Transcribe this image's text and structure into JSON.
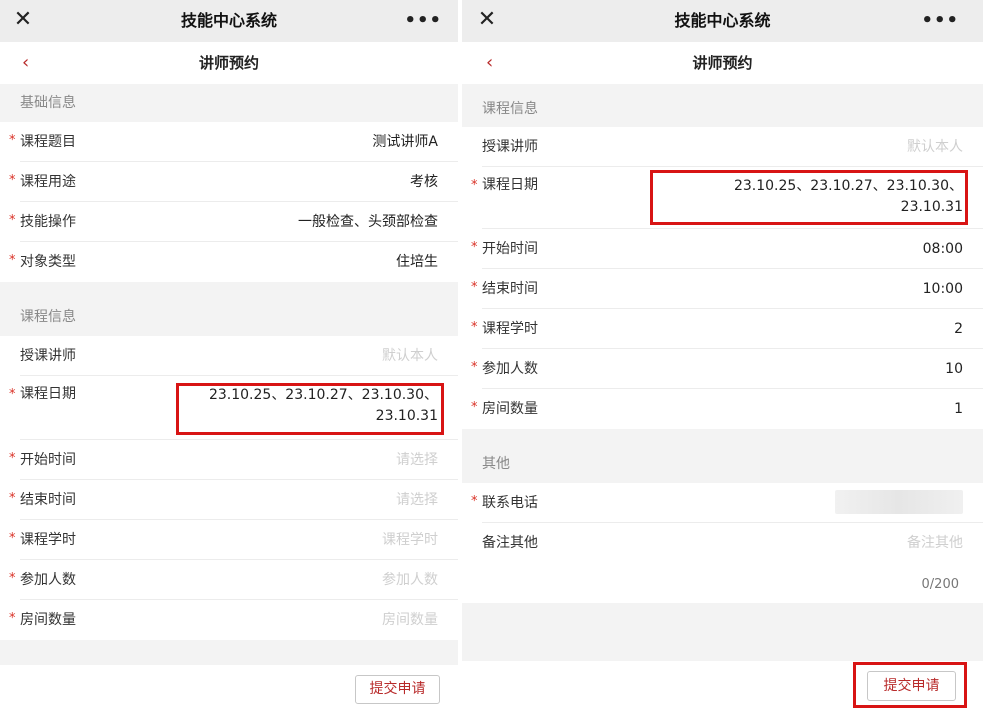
{
  "app_title": "技能中心系统",
  "page_title": "讲师预约",
  "icons": {
    "close": "close-icon",
    "more": "more-icon",
    "back": "back-icon"
  },
  "colors": {
    "accent": "#b82a2a",
    "required": "#d93025",
    "highlight": "#d81414"
  },
  "left": {
    "basic_section": "基础信息",
    "basic_rows": [
      {
        "label": "课程题目",
        "value": "测试讲师A",
        "required": true
      },
      {
        "label": "课程用途",
        "value": "考核",
        "required": true
      },
      {
        "label": "技能操作",
        "value": "一般检查、头颈部检查",
        "required": true
      },
      {
        "label": "对象类型",
        "value": "住培生",
        "required": true
      }
    ],
    "course_section": "课程信息",
    "teacher": {
      "label": "授课讲师",
      "placeholder": "默认本人"
    },
    "date": {
      "label": "课程日期",
      "line1": "23.10.25、23.10.27、23.10.30、",
      "line2": "23.10.31"
    },
    "rows": [
      {
        "label": "开始时间",
        "placeholder": "请选择"
      },
      {
        "label": "结束时间",
        "placeholder": "请选择"
      },
      {
        "label": "课程学时",
        "placeholder": "课程学时"
      },
      {
        "label": "参加人数",
        "placeholder": "参加人数"
      },
      {
        "label": "房间数量",
        "placeholder": "房间数量"
      }
    ],
    "submit": "提交申请"
  },
  "right": {
    "course_section": "课程信息",
    "teacher": {
      "label": "授课讲师",
      "placeholder": "默认本人"
    },
    "date": {
      "label": "课程日期",
      "line1": "23.10.25、23.10.27、23.10.30、",
      "line2": "23.10.31"
    },
    "rows": [
      {
        "label": "开始时间",
        "value": "08:00"
      },
      {
        "label": "结束时间",
        "value": "10:00"
      },
      {
        "label": "课程学时",
        "value": "2"
      },
      {
        "label": "参加人数",
        "value": "10"
      },
      {
        "label": "房间数量",
        "value": "1"
      }
    ],
    "other_section": "其他",
    "phone": {
      "label": "联系电话"
    },
    "remark": {
      "label": "备注其他",
      "placeholder": "备注其他",
      "counter": "0/200"
    },
    "submit": "提交申请"
  }
}
